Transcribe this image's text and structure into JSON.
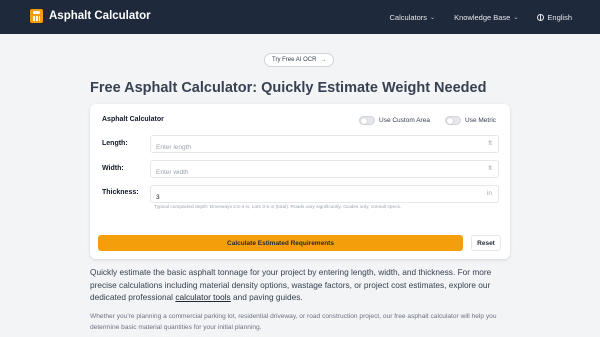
{
  "navbar": {
    "brand_name": "Asphalt Calculator",
    "items": [
      {
        "label": "Calculators"
      },
      {
        "label": "Knowledge Base"
      },
      {
        "label": "English"
      }
    ],
    "background": "#1e293b"
  },
  "ocr_button": {
    "label": "Try Free AI OCR",
    "arrow": "→"
  },
  "headline": "Free Asphalt Calculator: Quickly Estimate Weight Needed",
  "calculator": {
    "title": "Asphalt Calculator",
    "toggles": [
      {
        "label": "Use Custom Area",
        "on": false
      },
      {
        "label": "Use Metric",
        "on": false
      }
    ],
    "fields": {
      "length": {
        "label": "Length:",
        "placeholder": "Enter length",
        "value": "",
        "unit": "ft"
      },
      "width": {
        "label": "Width:",
        "placeholder": "Enter width",
        "value": "",
        "unit": "ft"
      },
      "thickness": {
        "label": "Thickness:",
        "placeholder": "",
        "value": "3",
        "unit": "in"
      }
    },
    "hint": "Typical compacted depth: Driveways 2.5-4 in, Lots 3-5 in (total). Roads vary significantly. Guides only, consult specs.",
    "calculate_label": "Calculate Estimated Requirements",
    "reset_label": "Reset",
    "accent": "#f59e0b"
  },
  "intro": {
    "text_before": "Quickly estimate the basic asphalt tonnage for your project by entering length, width, and thickness. For more precise calculations including material density options, wastage factors, or project cost estimates, explore our dedicated professional ",
    "link_text": "calculator tools",
    "text_after": " and paving guides."
  },
  "secondary_text": "Whether you're planning a commercial parking lot, residential driveway, or road construction project, our free asphalt calculator will help you determine basic material quantities for your initial planning."
}
